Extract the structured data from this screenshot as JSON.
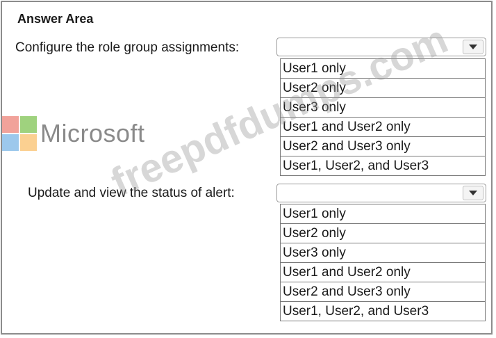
{
  "answer_area": {
    "title": "Answer Area"
  },
  "questions": [
    {
      "prompt": "Configure the role group assignments:",
      "selected": "",
      "options": [
        "User1 only",
        "User2 only",
        "User3 only",
        "User1 and User2 only",
        "User2 and User3  only",
        "User1, User2, and User3"
      ]
    },
    {
      "prompt": "Update and view the status of alert:",
      "selected": "",
      "options": [
        "User1 only",
        "User2 only",
        "User3 only",
        "User1 and User2 only",
        "User2 and User3  only",
        "User1, User2, and User3"
      ]
    }
  ],
  "logo": {
    "text": "Microsoft",
    "colors": [
      "#f1a29a",
      "#9fd27e",
      "#9cc8ec",
      "#fbd091"
    ]
  },
  "watermark": {
    "text": "freepdfdumps.com"
  }
}
